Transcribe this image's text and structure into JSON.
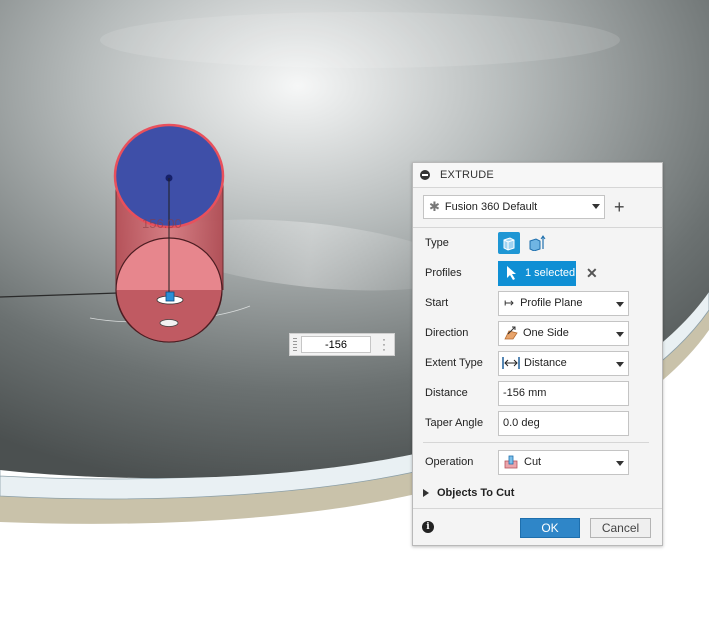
{
  "viewport": {
    "dimension_input_value": "-156",
    "ghost_dimension": "156.00"
  },
  "extrude": {
    "title": "EXTRUDE",
    "preset": "Fusion 360 Default",
    "type_label": "Type",
    "profiles_label": "Profiles",
    "profiles_value": "1 selected",
    "start_label": "Start",
    "start_value": "Profile Plane",
    "direction_label": "Direction",
    "direction_value": "One Side",
    "extent_type_label": "Extent Type",
    "extent_type_value": "Distance",
    "distance_label": "Distance",
    "distance_value": "-156 mm",
    "taper_label": "Taper Angle",
    "taper_value": "0.0 deg",
    "operation_label": "Operation",
    "operation_value": "Cut",
    "objects_to_cut_label": "Objects To Cut",
    "ok_label": "OK",
    "cancel_label": "Cancel"
  },
  "icons": [
    "star-icon",
    "add-icon",
    "extrude-solid-icon",
    "extrude-thin-icon",
    "pointer-icon",
    "clear-icon",
    "profile-plane-icon",
    "one-side-icon",
    "distance-icon",
    "cut-icon",
    "info-icon",
    "collapse-icon"
  ],
  "colors": {
    "accent": "#0f8fd4",
    "ok": "#2f86c8",
    "profile_face": "#3e4fa8",
    "cut_body": "#d56a72"
  }
}
